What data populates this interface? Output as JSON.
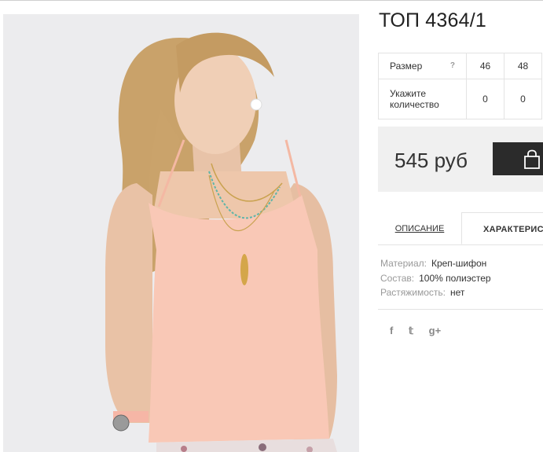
{
  "product": {
    "title": "ТОП 4364/1",
    "image_alt": "Девушка в персиковом топе на бретелях"
  },
  "size_table": {
    "size_label": "Размер",
    "help": "?",
    "sizes": [
      "46",
      "48"
    ],
    "qty_label_line1": "Укажите",
    "qty_label_line2": "количество",
    "quantities": [
      "0",
      "0"
    ]
  },
  "purchase": {
    "price": "545 руб",
    "cart_icon": "shopping-bag-icon"
  },
  "tabs": [
    {
      "label": "ОПИСАНИЕ"
    },
    {
      "label": "ХАРАКТЕРИСТИКИ"
    }
  ],
  "specs": [
    {
      "key": "Материал:",
      "value": "Креп-шифон"
    },
    {
      "key": "Состав:",
      "value": "100% полиэстер"
    },
    {
      "key": "Растяжимость:",
      "value": "нет"
    }
  ],
  "social": [
    {
      "icon": "facebook-icon",
      "glyph": "f"
    },
    {
      "icon": "twitter-icon",
      "glyph": "𝕥"
    },
    {
      "icon": "google-plus-icon",
      "glyph": "g+"
    }
  ],
  "colors": {
    "top_fabric": "#f9c8b6",
    "button": "#2b2b2b",
    "price_bg": "#f0f0f0"
  }
}
